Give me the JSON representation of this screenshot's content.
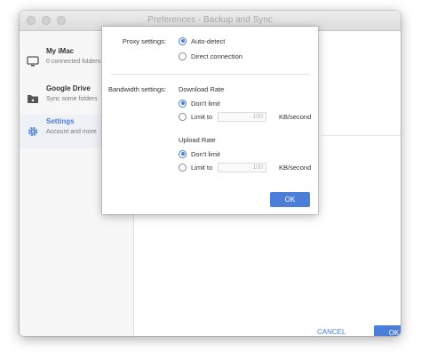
{
  "window": {
    "title": "Preferences - Backup and Sync"
  },
  "sidebar": {
    "items": [
      {
        "title": "My iMac",
        "subtitle": "0 connected folders",
        "icon": "monitor-icon"
      },
      {
        "title": "Google Drive",
        "subtitle": "Sync some folders",
        "icon": "drive-folder-icon"
      },
      {
        "title": "Settings",
        "subtitle": "Account and more",
        "icon": "gear-icon"
      }
    ]
  },
  "footer": {
    "cancel_label": "CANCEL",
    "ok_label": "OK"
  },
  "dialog": {
    "proxy_label": "Proxy settings:",
    "proxy_options": [
      "Auto-detect",
      "Direct connection"
    ],
    "bandwidth_label": "Bandwidth settings:",
    "download": {
      "title": "Download Rate",
      "options": [
        "Don't limit",
        "Limit to"
      ],
      "value": "100",
      "unit": "KB/second"
    },
    "upload": {
      "title": "Upload Rate",
      "options": [
        "Don't limit",
        "Limit to"
      ],
      "value": "100",
      "unit": "KB/second"
    },
    "ok_label": "OK"
  },
  "colors": {
    "accent": "#4a7ed8"
  }
}
